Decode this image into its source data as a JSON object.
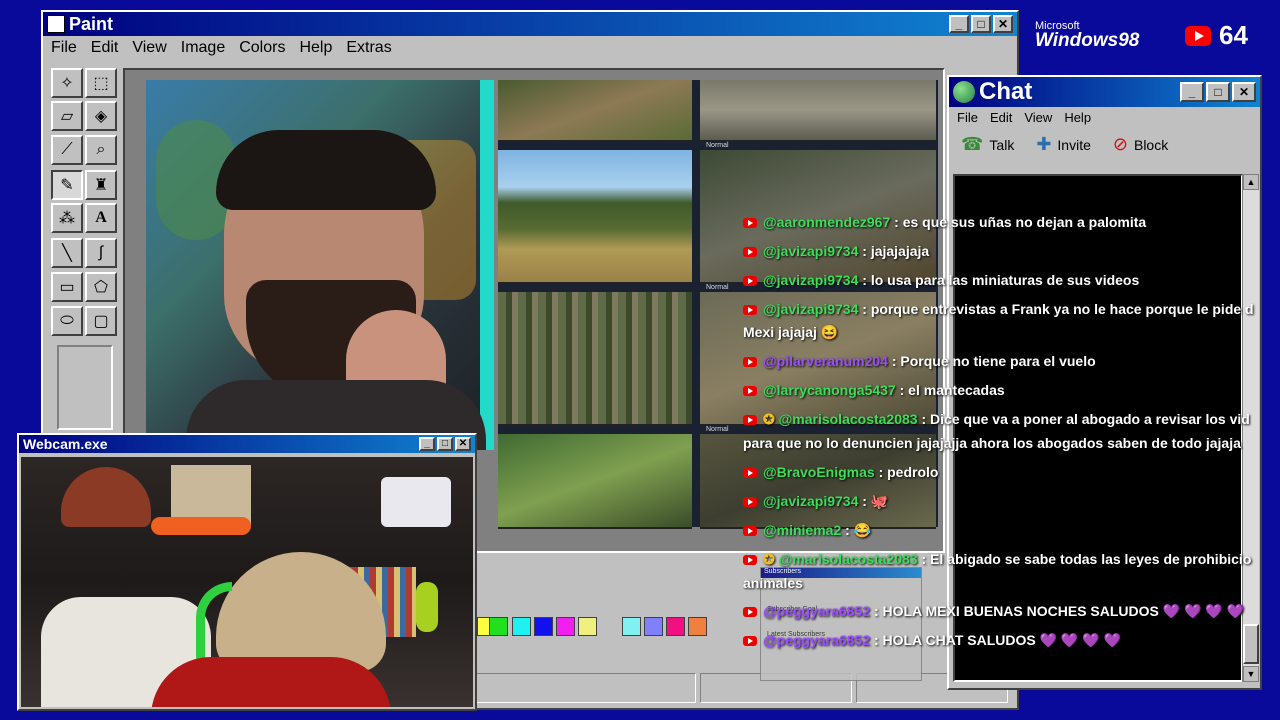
{
  "paint": {
    "title": "Paint",
    "menu": [
      "File",
      "Edit",
      "View",
      "Image",
      "Colors",
      "Help",
      "Extras"
    ]
  },
  "webcam": {
    "title": "Webcam.exe"
  },
  "chat": {
    "title": "Chat",
    "menu": [
      "File",
      "Edit",
      "View",
      "Help"
    ],
    "talk": "Talk",
    "invite": "Invite",
    "block": "Block"
  },
  "desktop": {
    "logo_top": "Microsoft",
    "logo_main": "Windows98",
    "viewer_count": "64"
  },
  "subscribers_widget": {
    "title": "Subscribers",
    "goal": "Subscriber Goal",
    "latest": "Latest Subscribers"
  },
  "camera_labels": [
    "Normal",
    "Normal",
    "Normal"
  ],
  "messages": [
    {
      "user": "@aaronmendez967",
      "text": ": es que sus uñas no dejan a palomita"
    },
    {
      "user": "@javizapi9734",
      "text": ": jajajajaja"
    },
    {
      "user": "@javizapi9734",
      "text": ": lo usa para las miniaturas de sus videos"
    },
    {
      "user": "@javizapi9734",
      "text": ": porque entrevistas a Frank ya no le hace porque le pide d"
    },
    {
      "user": "",
      "text": "Mexi jajajaj 😆"
    },
    {
      "user": "@pilarveranum204",
      "text": ": Porque no tiene para el vuelo",
      "purple": true
    },
    {
      "user": "@larrycanonga5437",
      "text": ": el mantecadas"
    },
    {
      "user": "@marisolacosta2083",
      "text": ": Dice que va a poner al abogado a revisar los vid"
    },
    {
      "user": "",
      "text": "para que no lo denuncien jajajajja ahora los abogados saben de todo jajaja"
    },
    {
      "user": "@BravoEnigmas",
      "text": ": pedrolo"
    },
    {
      "user": "@javizapi9734",
      "text": ": 🐙"
    },
    {
      "user": "@miniema2",
      "text": ": 😂"
    },
    {
      "user": "@marisolacosta2083",
      "text": ": El abigado se sabe todas las leyes de prohibicio"
    },
    {
      "user": "",
      "text": "animales"
    },
    {
      "user": "@peggyara6852",
      "text": ": HOLA MEXI BUENAS NOCHES SALUDOS 💜 💜 💜 💜",
      "purple": true
    },
    {
      "user": "@peggyara6852",
      "text": ": HOLA CHAT SALUDOS 💜 💜 💜 💜",
      "purple": true
    }
  ],
  "palette": [
    "#ffff40",
    "#20e020",
    "#20f0f0",
    "#1010f0",
    "#f020f0",
    "#f0f080",
    "#80f0f0",
    "#8080ff",
    "#f01080",
    "#f08040"
  ]
}
